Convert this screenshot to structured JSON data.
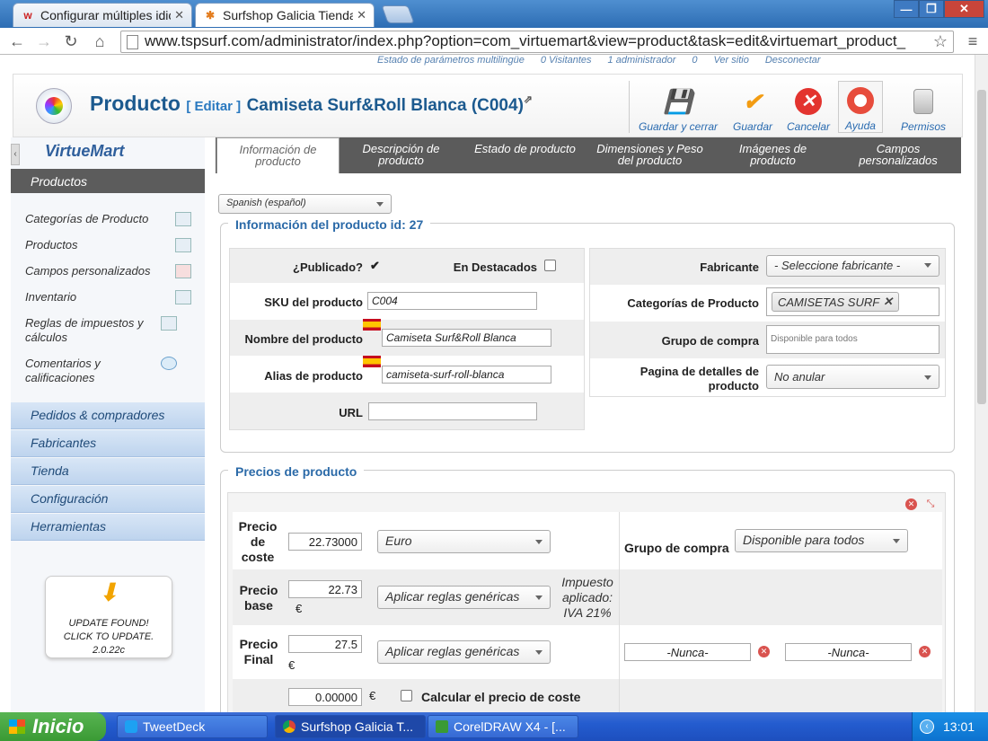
{
  "browser": {
    "tabs": [
      {
        "label": "Configurar múltiples idic",
        "favicon": "w"
      },
      {
        "label": "Surfshop Galicia Tienda",
        "favicon": "joomla"
      }
    ],
    "url": "www.tspsurf.com/administrator/index.php?option=com_virtuemart&view=product&task=edit&virtuemart_product_"
  },
  "status_strip": [
    "Estado de parámetros multilingüe",
    "0 Visitantes",
    "1 administrador",
    "0",
    "Ver sitio",
    "Desconectar"
  ],
  "header": {
    "title": "Producto",
    "edit": "[ Editar ]",
    "product_name": "Camiseta Surf&Roll Blanca (C004)",
    "buttons": [
      "Guardar y cerrar",
      "Guardar",
      "Cancelar",
      "Ayuda",
      "Permisos"
    ]
  },
  "sidebar": {
    "logo": "VirtueMart",
    "section": "Productos",
    "items": [
      "Categorías de Producto",
      "Productos",
      "Campos personalizados",
      "Inventario",
      "Reglas de impuestos y cálculos",
      "Comentarios y calificaciones"
    ],
    "nav": [
      "Pedidos & compradores",
      "Fabricantes",
      "Tienda",
      "Configuración",
      "Herramientas"
    ],
    "update": {
      "line1": "UPDATE FOUND!",
      "line2": "CLICK TO UPDATE.",
      "line3": "2.0.22c"
    }
  },
  "tabs": [
    "Información de producto",
    "Descripción de producto",
    "Estado de producto",
    "Dimensiones y Peso del producto",
    "Imágenes de producto",
    "Campos personalizados"
  ],
  "language_select": "Spanish (español)",
  "info": {
    "legend": "Información del producto id: 27",
    "published_label": "¿Publicado?",
    "featured_label": "En Destacados",
    "sku_label": "SKU del producto",
    "sku": "C004",
    "name_label": "Nombre del producto",
    "name": "Camiseta Surf&Roll Blanca",
    "alias_label": "Alias de producto",
    "alias": "camiseta-surf-roll-blanca",
    "url_label": "URL",
    "url": "",
    "manufacturer_label": "Fabricante",
    "manufacturer": "- Seleccione fabricante -",
    "categories_label": "Categorías de Producto",
    "category_tag": "CAMISETAS SURF",
    "shoppergroup_label": "Grupo de compra",
    "shoppergroup_placeholder": "Disponible para todos",
    "detailpage_label": "Pagina de detalles de producto",
    "detailpage": "No anular"
  },
  "prices": {
    "legend": "Precios de producto",
    "cost_label": "Precio de coste",
    "cost": "22.73000",
    "currency": "Euro",
    "shoppergroup_label": "Grupo de compra",
    "shoppergroup": "Disponible para todos",
    "base_label": "Precio base",
    "base": "22.73",
    "euro": "€",
    "rules1": "Aplicar reglas genéricas",
    "tax_note": "Impuesto aplicado: IVA 21%",
    "final_label": "Precio Final",
    "final": "27.5",
    "rules2": "Aplicar reglas genéricas",
    "never1": "-Nunca-",
    "never2": "-Nunca-",
    "extra": "0.00000",
    "calc_label": "Calcular el precio de coste"
  },
  "taskbar": {
    "start": "Inicio",
    "tasks": [
      "TweetDeck",
      "Surfshop Galicia T...",
      "CorelDRAW X4 - [..."
    ],
    "time": "13:01"
  }
}
